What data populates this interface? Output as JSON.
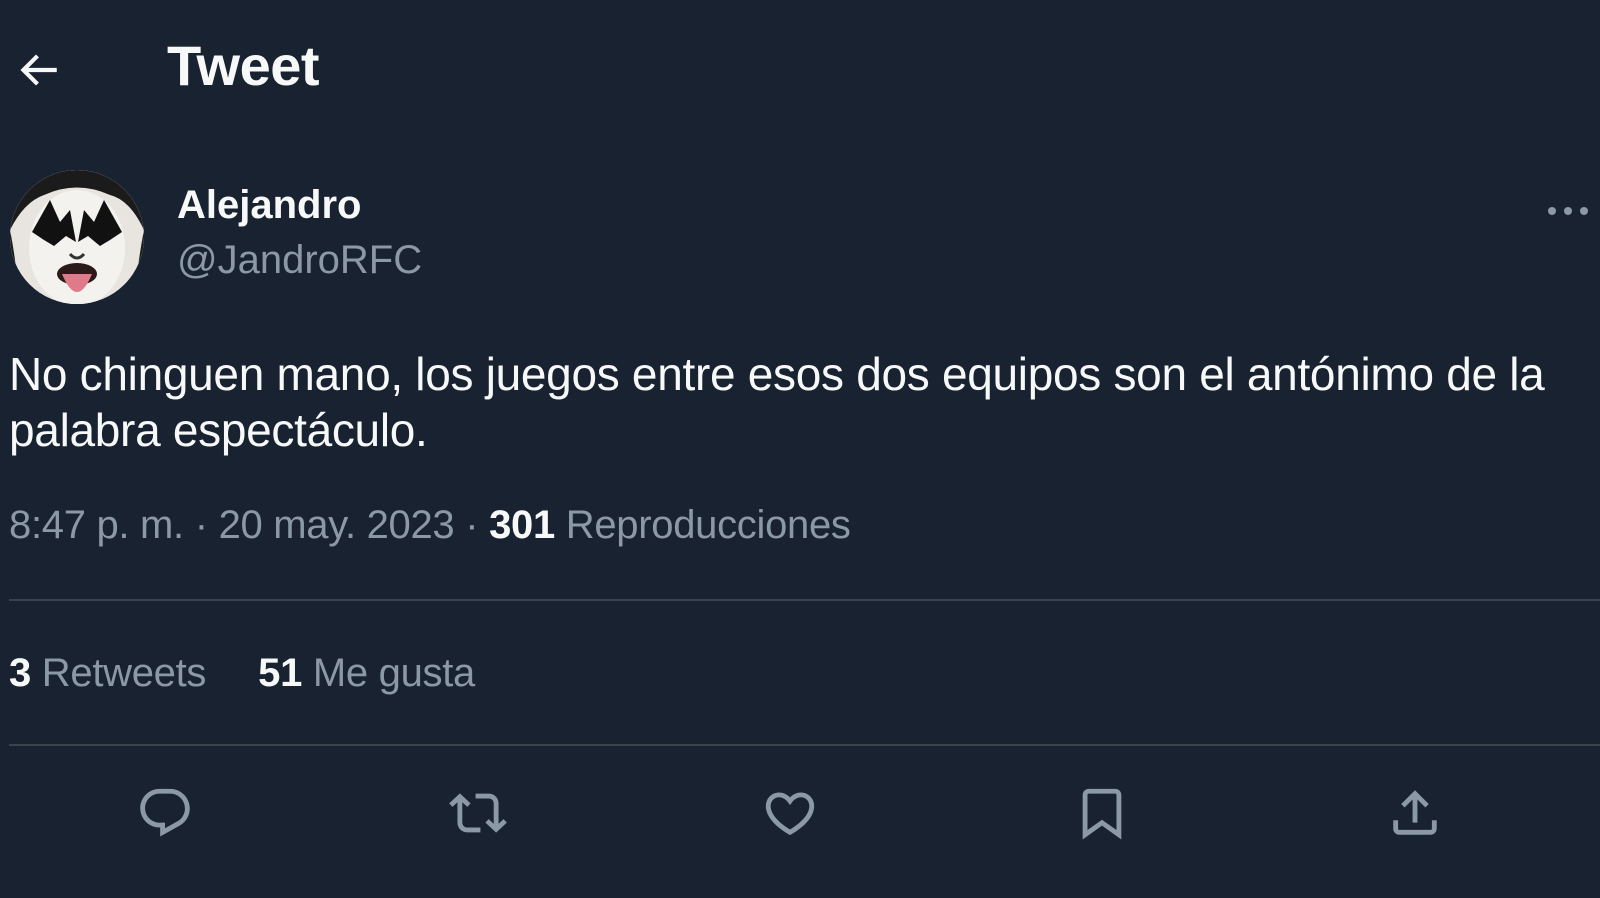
{
  "header": {
    "title": "Tweet",
    "back_icon": "arrow-left-icon"
  },
  "author": {
    "name": "Alejandro",
    "handle": "@JandroRFC",
    "avatar": "avatar-kiss-makeup"
  },
  "tweet": {
    "text": "No chinguen mano, los juegos entre esos dos equipos son el antónimo de la palabra espectáculo."
  },
  "meta": {
    "time": "8:47 p. m.",
    "date": "20 may. 2023",
    "separator": "·",
    "views_count": "301",
    "views_label": "Reproducciones"
  },
  "stats": {
    "retweets_count": "3",
    "retweets_label": "Retweets",
    "likes_count": "51",
    "likes_label": "Me gusta"
  },
  "actions": [
    {
      "name": "reply",
      "icon": "reply-icon"
    },
    {
      "name": "retweet",
      "icon": "retweet-icon"
    },
    {
      "name": "like",
      "icon": "heart-icon"
    },
    {
      "name": "bookmark",
      "icon": "bookmark-icon"
    },
    {
      "name": "share",
      "icon": "share-icon"
    }
  ],
  "colors": {
    "background": "#192230",
    "text_primary": "#f7f9f9",
    "text_secondary": "#8b98a5",
    "divider": "#38444d"
  }
}
